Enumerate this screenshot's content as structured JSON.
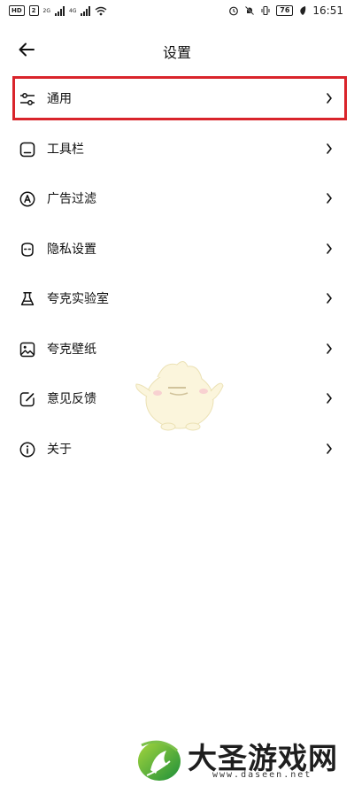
{
  "status_bar": {
    "network_badges": [
      "HD",
      "2"
    ],
    "signal_1": "2G",
    "signal_2": "4G",
    "battery": "76",
    "time": "16:51"
  },
  "header": {
    "title": "设置"
  },
  "settings_items": [
    {
      "label": "通用",
      "icon": "sliders-icon",
      "highlighted": true
    },
    {
      "label": "工具栏",
      "icon": "toolbar-icon"
    },
    {
      "label": "广告过滤",
      "icon": "ad-filter-icon"
    },
    {
      "label": "隐私设置",
      "icon": "privacy-mask-icon"
    },
    {
      "label": "夸克实验室",
      "icon": "flask-icon"
    },
    {
      "label": "夸克壁纸",
      "icon": "image-icon"
    },
    {
      "label": "意见反馈",
      "icon": "edit-feedback-icon"
    },
    {
      "label": "关于",
      "icon": "info-icon"
    }
  ],
  "colors": {
    "highlight_border": "#d9242b",
    "text": "#111111",
    "background": "#ffffff"
  },
  "watermark": {
    "name": "大圣游戏网",
    "url": "www.daseen.net"
  }
}
